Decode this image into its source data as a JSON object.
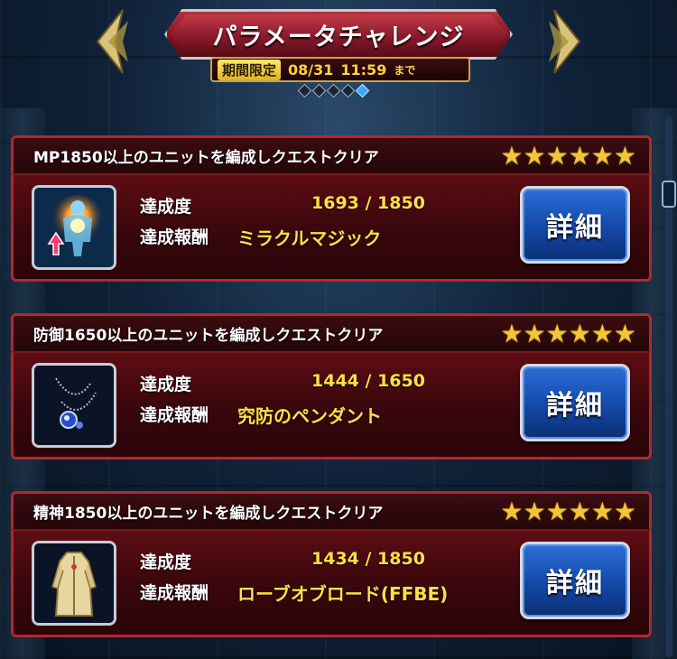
{
  "header": {
    "title": "パラメータチャレンジ",
    "period_badge": "期間限定",
    "period_date": "08/31",
    "period_time": "11:59",
    "period_until": "まで",
    "page_count": 5,
    "active_page": 5
  },
  "quests": [
    {
      "title": "MP1850以上のユニットを編成しクエストクリア",
      "stars": "★★★★★★",
      "progress_label": "達成度",
      "progress_value": "1693 / 1850",
      "reward_label": "達成報酬",
      "reward_value": "ミラクルマジック",
      "detail_label": "詳細",
      "item_icon": "miracle-magic-icon"
    },
    {
      "title": "防御1650以上のユニットを編成しクエストクリア",
      "stars": "★★★★★★",
      "progress_label": "達成度",
      "progress_value": "1444 / 1650",
      "reward_label": "達成報酬",
      "reward_value": "究防のペンダント",
      "detail_label": "詳細",
      "item_icon": "pendant-icon"
    },
    {
      "title": "精神1850以上のユニットを編成しクエストクリア",
      "stars": "★★★★★★",
      "progress_label": "達成度",
      "progress_value": "1434 / 1850",
      "reward_label": "達成報酬",
      "reward_value": "ローブオブロード(FFBE)",
      "detail_label": "詳細",
      "item_icon": "robe-icon"
    }
  ],
  "colors": {
    "accent_gold": "#ffe044",
    "card_border": "#b3272f",
    "button_blue": "#1448a8"
  }
}
